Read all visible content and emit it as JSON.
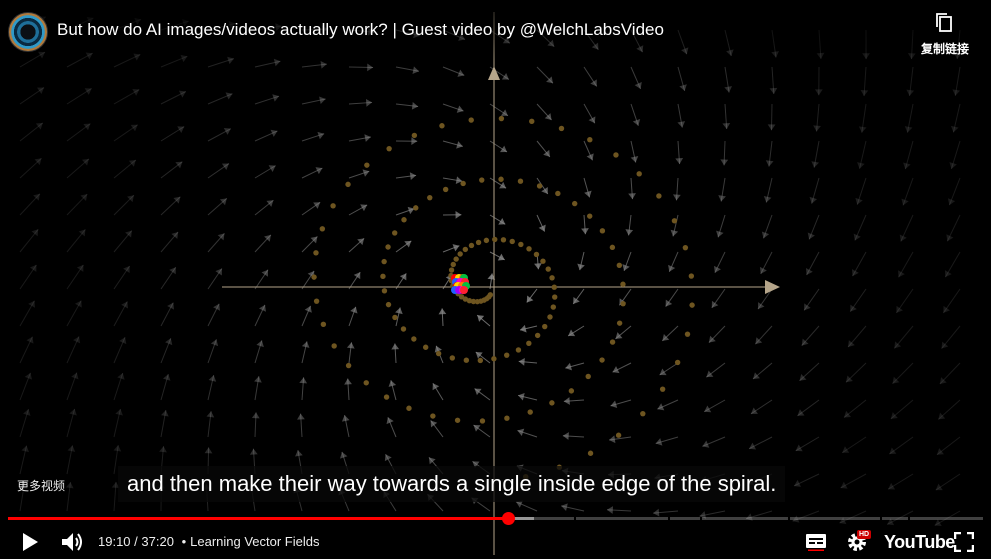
{
  "window": {
    "title": "But how do AI images/videos actually work? | Guest video by @WelchLabsVideo",
    "copy_link_label": "复制链接",
    "more_videos_label": "更多视频"
  },
  "video": {
    "caption": "and then make their way towards a single inside edge of the spiral."
  },
  "player": {
    "current_time": "19:10",
    "duration": "37:20",
    "separator": " / ",
    "chapter_bullet": "•",
    "chapter_title": "Learning Vector Fields",
    "progress_fraction": 0.513,
    "buffered_fraction": 0.54,
    "brand": "YouTube",
    "quality_badge": "HD"
  },
  "colors": {
    "progress_played": "#ff0000",
    "caption_bg": "rgba(8,8,8,0.75)",
    "axis": "#b5a58a",
    "spiral_dot": "#6e5520",
    "field_arrow": "#8a8a8a"
  },
  "icons": [
    "copy-icon",
    "play-icon",
    "volume-icon",
    "subtitles-icon",
    "settings-icon",
    "fullscreen-icon"
  ]
}
